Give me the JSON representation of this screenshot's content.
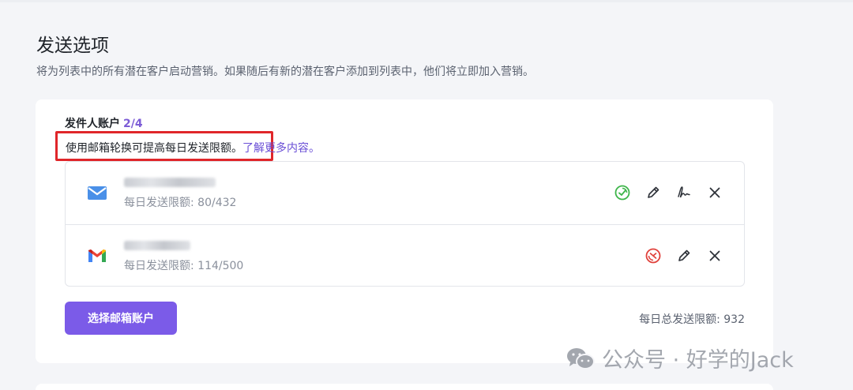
{
  "header": {
    "title": "发送选项",
    "subtitle": "将为列表中的所有潜在客户启动营销。如果随后有新的潜在客户添加到列表中，他们将立即加入营销。"
  },
  "sender": {
    "label": "发件人账户",
    "count": "2/4",
    "hint_text": "使用邮箱轮换可提高每日发送限额。",
    "hint_link": "了解更多内容。"
  },
  "accounts": [
    {
      "provider": "email",
      "logo_icon": "envelope-icon",
      "limit_text": "每日发送限额: 80/432",
      "status_color": "#3eb54a",
      "status_icon": "active-status-icon",
      "actions": [
        "status",
        "edit",
        "signature",
        "remove"
      ]
    },
    {
      "provider": "gmail",
      "logo_icon": "gmail-icon",
      "limit_text": "每日发送限额: 114/500",
      "status_color": "#e0403a",
      "status_icon": "paused-status-icon",
      "actions": [
        "status",
        "edit",
        "remove"
      ]
    }
  ],
  "footer": {
    "select_button": "选择邮箱账户",
    "total_limit": "每日总发送限额:  932"
  },
  "watermark": {
    "text": "公众号 · 好学的Jack"
  },
  "colors": {
    "accent": "#7b5be8",
    "link": "#6a4fd6",
    "highlight_border": "#e0262a"
  }
}
